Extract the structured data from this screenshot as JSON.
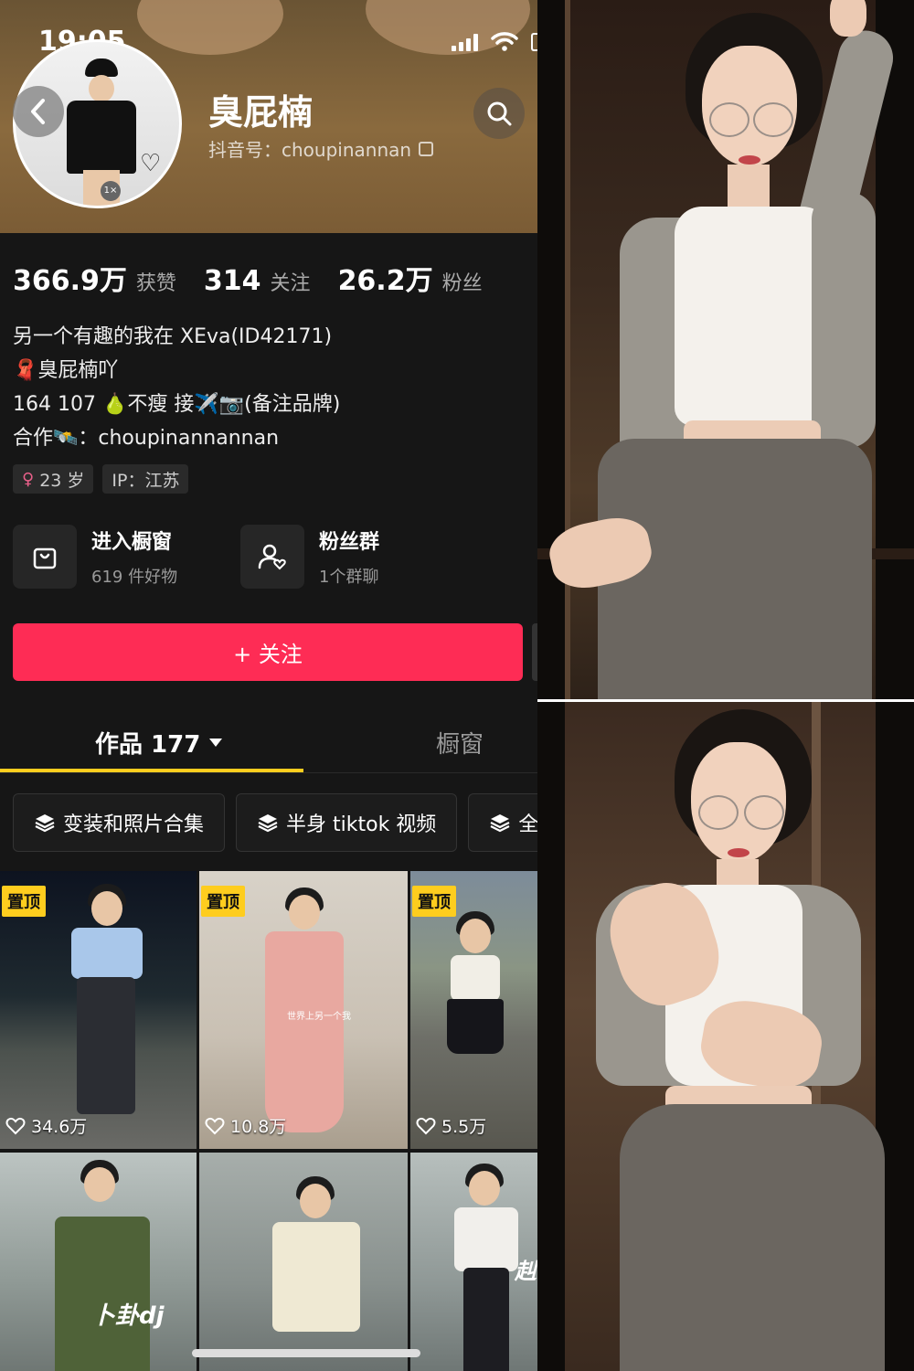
{
  "status_bar": {
    "time": "19:05"
  },
  "profile": {
    "nickname": "臭屁楠",
    "douyin_id": "抖音号：choupinannan",
    "avatar_badge": "1×",
    "stats": [
      {
        "value": "366.9万",
        "label": "获赞"
      },
      {
        "value": "314",
        "label": "关注"
      },
      {
        "value": "26.2万",
        "label": "粉丝"
      }
    ],
    "bio": [
      "另一个有趣的我在 XEva(ID42171)",
      "🧣臭屁楠吖",
      "164 107 🍐不瘦 接✈️📷(备注品牌)",
      "合作🛰️：choupinannannan"
    ],
    "tags": {
      "age": "23 岁",
      "ip": "IP：江苏"
    }
  },
  "shortcuts": {
    "shop": {
      "title": "进入橱窗",
      "subtitle": "619 件好物"
    },
    "fans": {
      "title": "粉丝群",
      "subtitle": "1个群聊"
    }
  },
  "follow_button": "+ 关注",
  "tabs": {
    "works": "作品 177",
    "window": "橱窗"
  },
  "collections": [
    "变装和照片合集",
    "半身 tiktok 视频",
    "全"
  ],
  "videos": [
    {
      "pinned": "置顶",
      "likes": "34.6万"
    },
    {
      "pinned": "置顶",
      "likes": "10.8万",
      "caption": "世界上另一个我"
    },
    {
      "pinned": "置顶",
      "likes": "5.5万"
    },
    {
      "overlay": "卜卦dj"
    },
    {
      "overlay": ""
    },
    {
      "overlay": "赳"
    }
  ],
  "colors": {
    "accent_red": "#fe2c55",
    "tab_underline": "#fecd1e",
    "pin_badge": "#fecd1e",
    "background": "#161616"
  },
  "icons": [
    "back-arrow-icon",
    "search-icon",
    "copy-icon",
    "shopping-bag-icon",
    "fan-group-icon",
    "layers-icon",
    "heart-icon",
    "caret-down-icon"
  ]
}
